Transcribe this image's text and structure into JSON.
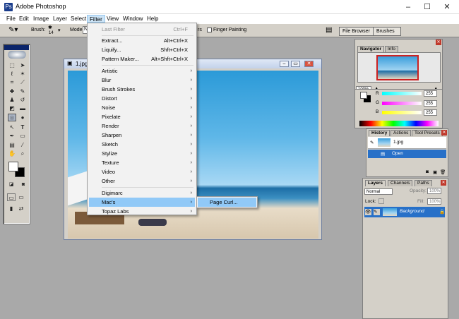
{
  "app": {
    "title": "Adobe Photoshop",
    "icon": "Ps"
  },
  "window_controls": {
    "minimize": "–",
    "maximize": "☐",
    "close": "✕"
  },
  "menubar": [
    "File",
    "Edit",
    "Image",
    "Layer",
    "Select",
    "Filter",
    "View",
    "Window",
    "Help"
  ],
  "options_bar": {
    "brush_label": "Brush:",
    "brush_size": "14",
    "mode_label": "Mode:",
    "mode_value": "N",
    "finger_painting": "Finger Painting",
    "tabs": [
      "File Browser",
      "Brushes"
    ]
  },
  "document": {
    "title": "1.jpg"
  },
  "filter_menu": {
    "last_filter": {
      "label": "Last Filter",
      "shortcut": "Ctrl+F"
    },
    "extract": {
      "label": "Extract...",
      "shortcut": "Alt+Ctrl+X"
    },
    "liquify": {
      "label": "Liquify...",
      "shortcut": "Shft+Ctrl+X"
    },
    "pattern_maker": {
      "label": "Pattern Maker...",
      "shortcut": "Alt+Shft+Ctrl+X"
    },
    "groups": [
      "Artistic",
      "Blur",
      "Brush Strokes",
      "Distort",
      "Noise",
      "Pixelate",
      "Render",
      "Sharpen",
      "Sketch",
      "Stylize",
      "Texture",
      "Video",
      "Other"
    ],
    "plugins": [
      "Digimarc",
      "Mac's",
      "Topaz Labs"
    ]
  },
  "submenu": {
    "page_curl": "Page Curl..."
  },
  "navigator": {
    "tabs": [
      "Navigator",
      "Info"
    ],
    "zoom": "100%"
  },
  "color_palette": {
    "labels": [
      "R",
      "G",
      "B"
    ],
    "values": [
      "255",
      "255",
      "255"
    ]
  },
  "history": {
    "tabs": [
      "History",
      "Actions",
      "Tool Presets"
    ],
    "snapshot": "1.jpg",
    "step": "Open"
  },
  "layers": {
    "tabs": [
      "Layers",
      "Channels",
      "Paths"
    ],
    "blend": "Normal",
    "opacity_label": "Opacity:",
    "opacity": "100%",
    "lock_label": "Lock:",
    "fill_label": "Fill:",
    "fill": "100%",
    "layer_name": "Background"
  }
}
